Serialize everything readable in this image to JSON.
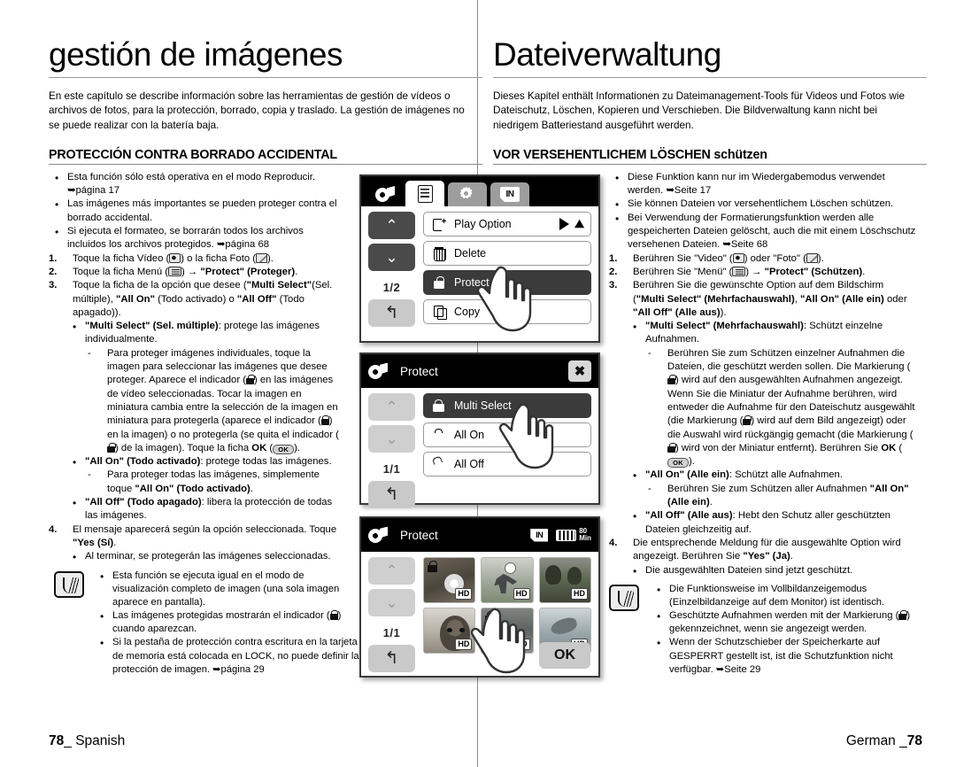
{
  "spanish": {
    "chapter_title": "gestión de imágenes",
    "intro": "En este capítulo se describe información sobre las herramientas de gestión de vídeos o archivos de fotos, para la protección, borrado, copia y traslado. La gestión de imágenes no se puede realizar con la batería baja.",
    "section_title": "PROTECCIÓN CONTRA BORRADO ACCIDENTAL",
    "bullets": [
      "Esta función sólo está operativa en el modo Reproducir. ➥página 17",
      "Las imágenes más importantes se pueden proteger contra el borrado accidental.",
      "Si ejecuta el formateo, se borrarán todos los archivos incluidos los archivos protegidos. ➥página 68"
    ],
    "step1_prefix": "Toque la ficha Vídeo (",
    "step1_mid": ") o la ficha Foto (",
    "step1_suffix": ").",
    "step2_prefix": "Toque la ficha Menú (",
    "step2_mid": ") → ",
    "step2_bold": "\"Protect\" (Proteger)",
    "step2_suffix": ".",
    "step3_text": "Toque la ficha de la opción que desee (\"Multi Select\"(Sel. múltiple), \"All On\" (Todo activado) o \"All Off\" (Todo apagado)).",
    "opt_multi_bold": "\"Multi Select\" (Sel. múltiple)",
    "opt_multi_rest": ": protege las imágenes individualmente.",
    "multi_dash_1": "Para proteger imágenes individuales, toque la imagen para seleccionar las imágenes que desee proteger. Aparece el indicador (",
    "multi_dash_2": ")  en las imágenes de vídeo seleccionadas. Tocar la imagen en miniatura cambia entre la selección de la imagen en miniatura para protegerla (aparece el indicador (",
    "multi_dash_3": ") en la imagen) o no protegerla (se quita el indicador (",
    "multi_dash_4": ") de la imagen). Toque la ficha ",
    "multi_dash_ok_bold": "OK",
    "multi_dash_5": " (",
    "multi_dash_6": ").",
    "opt_allon_bold": "\"All On\" (Todo activado)",
    "opt_allon_rest": ": protege todas las imágenes.",
    "allon_dash": "Para proteger todas las imágenes, simplemente toque ",
    "allon_dash_bold": "\"All On\" (Todo activado)",
    "allon_dash_end": ".",
    "opt_alloff_bold": "\"All Off\" (Todo apagado)",
    "opt_alloff_rest": ": libera la protección de todas las imágenes.",
    "step4_text": "El mensaje aparecerá según la opción seleccionada. Toque ",
    "step4_bold": "\"Yes (Sí)",
    "step4_end": ".",
    "step4_bullet": "Al terminar, se protegerán las imágenes seleccionadas.",
    "notes": [
      "Esta función se ejecuta igual en el modo de visualización completo de imagen (una sola imagen aparece en pantalla).",
      "Si la pestaña de protección contra escritura en la tarjeta de memoria está colocada en LOCK, no puede definir la protección de imagen. ➥página 29"
    ],
    "note_lock_prefix": "Las imágenes protegidas mostrarán el indicador (",
    "note_lock_suffix": ")  cuando aparezcan.",
    "footer_page": "78",
    "footer_lang": "Spanish"
  },
  "german": {
    "chapter_title": "Dateiverwaltung",
    "intro": "Dieses Kapitel enthält Informationen zu Dateimanagement-Tools für Videos und Fotos wie Dateischutz, Löschen, Kopieren und Verschieben. Die Bildverwaltung kann nicht bei niedrigem Batteriestand ausgeführt werden.",
    "section_title": "VOR VERSEHENTLICHEM LÖSCHEN schützen",
    "bullets": [
      "Diese Funktion kann nur im Wiedergabemodus verwendet werden. ➥Seite 17",
      "Sie können Dateien vor versehentlichem Löschen schützen.",
      "Bei Verwendung der Formatierungsfunktion werden alle gespeicherten Dateien gelöscht, auch die mit einem Löschschutz versehenen Dateien. ➥Seite 68"
    ],
    "step1_prefix": "Berühren Sie \"Video\" (",
    "step1_mid": ") oder \"Foto\" (",
    "step1_suffix": ").",
    "step2_prefix": "Berühren Sie \"Menü\" (",
    "step2_mid": ") → ",
    "step2_bold": "\"Protect\"",
    "step2_bold2": "(Schützen)",
    "step2_suffix": ".",
    "step3_text": "Berühren Sie die gewünschte Option auf dem Bildschirm (\"Multi Select\" (Mehrfachauswahl), \"All On\" (Alle ein) oder \"All Off\" (Alle aus)).",
    "opt_multi_bold": "\"Multi Select\" (Mehrfachauswahl)",
    "opt_multi_rest": ": Schützt einzelne Aufnahmen.",
    "multi_dash_1": "Berühren Sie zum Schützen einzelner Aufnahmen die Dateien, die geschützt werden sollen. Die Markierung (",
    "multi_dash_2": ") wird auf den ausgewählten Aufnahmen angezeigt. Wenn Sie die Miniatur der Aufnahme berühren, wird entweder die Aufnahme für den Dateischutz ausgewählt (die Markierung (",
    "multi_dash_3": ") wird auf dem Bild angezeigt) oder die Auswahl wird rückgängig gemacht (die Markierung (",
    "multi_dash_4": ") wird von der Miniatur entfernt). Berühren Sie ",
    "multi_dash_ok_bold": "OK",
    "multi_dash_5": " (",
    "multi_dash_6": ").",
    "opt_allon_bold": "\"All On\" (Alle ein)",
    "opt_allon_rest": ": Schützt alle Aufnahmen.",
    "allon_dash": "Berühren Sie zum Schützen aller Aufnahmen ",
    "allon_dash_bold": "\"All On\" (Alle ein)",
    "allon_dash_end": ".",
    "opt_alloff_bold": "\"All Off\" (Alle aus)",
    "opt_alloff_rest": ": Hebt den Schutz aller geschützten Dateien gleichzeitig auf.",
    "step4_text": "Die entsprechende Meldung für die ausgewählte Option wird angezeigt. Berühren Sie ",
    "step4_bold": "\"Yes\" (Ja)",
    "step4_end": ".",
    "step4_bullet": "Die ausgewählten Dateien sind jetzt geschützt.",
    "notes": [
      "Die Funktionsweise im Vollbildanzeigemodus (Einzelbildanzeige auf dem Monitor) ist identisch.",
      "Wenn der Schutzschieber der Speicherkarte auf GESPERRT gestellt ist, ist die Schutzfunktion nicht verfügbar. ➥Seite 29"
    ],
    "note_lock_prefix": "Geschützte Aufnahmen werden mit der Markierung (",
    "note_lock_suffix": ") gekennzeichnet, wenn sie angezeigt werden.",
    "footer_page": "78",
    "footer_lang": "German"
  },
  "screens": {
    "screen1": {
      "page_indicator": "1/2",
      "tabs": [
        "video-tab",
        "menu-tab",
        "settings-tab",
        "memory-in-tab"
      ],
      "rows": [
        {
          "label": "Play Option",
          "selected": false
        },
        {
          "label": "Delete",
          "selected": false
        },
        {
          "label": "Protect",
          "selected": true
        },
        {
          "label": "Copy",
          "selected": false
        }
      ]
    },
    "screen2": {
      "title": "Protect",
      "page_indicator": "1/1",
      "close_label": "✖",
      "rows": [
        {
          "label": "Multi Select",
          "selected": true
        },
        {
          "label": "All On",
          "selected": false
        },
        {
          "label": "All Off",
          "selected": false
        }
      ]
    },
    "screen3": {
      "title": "Protect",
      "page_indicator": "1/1",
      "memory_label": "IN",
      "battery_time": "80",
      "battery_unit": "Min",
      "ok_label": "OK",
      "hd_badge": "HD",
      "thumbs": [
        {
          "name": "flower-thumbnail",
          "locked": true
        },
        {
          "name": "soccer-thumbnail",
          "locked": false
        },
        {
          "name": "landscape-thumbnail",
          "locked": false
        },
        {
          "name": "dog-thumbnail",
          "locked": false
        },
        {
          "name": "beach-thumbnail",
          "locked": true
        },
        {
          "name": "dolphin-thumbnail",
          "locked": false
        }
      ]
    }
  }
}
